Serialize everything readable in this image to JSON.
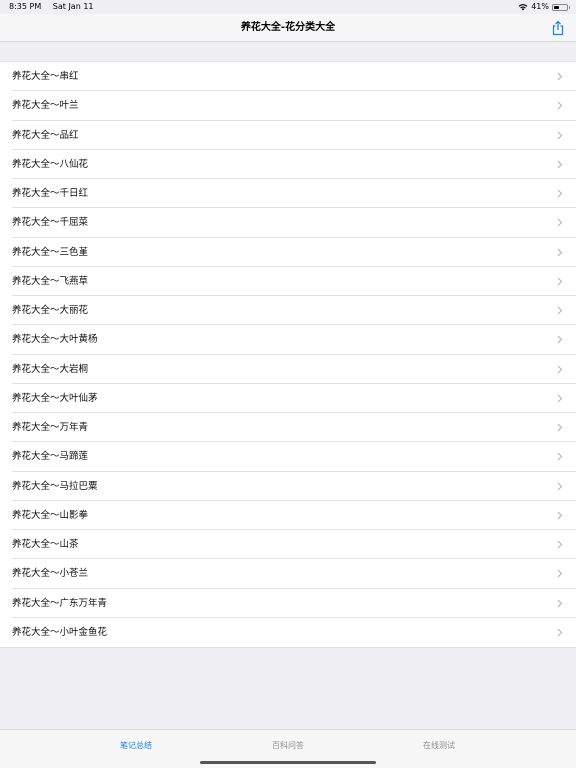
{
  "status_bar": {
    "time": "8:35 PM",
    "date": "Sat Jan 11",
    "battery_percent": "41%",
    "battery_level": 0.41
  },
  "nav": {
    "title": "养花大全-花分类大全",
    "share_icon": "share-icon"
  },
  "list_items": [
    "养花大全～串红",
    "养花大全～叶兰",
    "养花大全～品红",
    "养花大全～八仙花",
    "养花大全～千日红",
    "养花大全～千屈菜",
    "养花大全～三色堇",
    "养花大全～飞燕草",
    "养花大全～大丽花",
    "养花大全～大叶黄杨",
    "养花大全～大岩桐",
    "养花大全～大叶仙茅",
    "养花大全～万年青",
    "养花大全～马蹄莲",
    "养花大全～马拉巴粟",
    "养花大全～山影拳",
    "养花大全～山茶",
    "养花大全～小苍兰",
    "养花大全～广东万年青",
    "养花大全～小叶金鱼花"
  ],
  "tabs": [
    {
      "label": "笔记总结",
      "active": true
    },
    {
      "label": "百科问答",
      "active": false
    },
    {
      "label": "在线测试",
      "active": false
    }
  ],
  "colors": {
    "accent": "#1a7ef5",
    "inactive_tab": "#8e8e93",
    "background": "#efeff4"
  }
}
